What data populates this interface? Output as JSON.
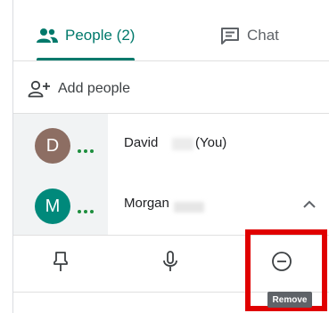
{
  "tabs": {
    "people_label": "People (2)",
    "chat_label": "Chat"
  },
  "add_people": {
    "label": "Add people"
  },
  "participants": [
    {
      "initial": "D",
      "name": "David",
      "suffix": "(You)",
      "avatar_color": "#8d6e63"
    },
    {
      "initial": "M",
      "name": "Morgan",
      "suffix": "",
      "avatar_color": "#00897b"
    }
  ],
  "actions": {
    "remove_tooltip": "Remove"
  },
  "colors": {
    "accent": "#00796b",
    "highlight": "#e00000",
    "speaking_dots": "#1e8e3e"
  },
  "icons": {
    "people_tab": "people-icon",
    "chat_tab": "chat-icon",
    "add_people": "add-person-icon",
    "collapse": "chevron-up-icon",
    "pin": "pin-icon",
    "mic": "microphone-icon",
    "remove": "remove-circle-icon"
  }
}
